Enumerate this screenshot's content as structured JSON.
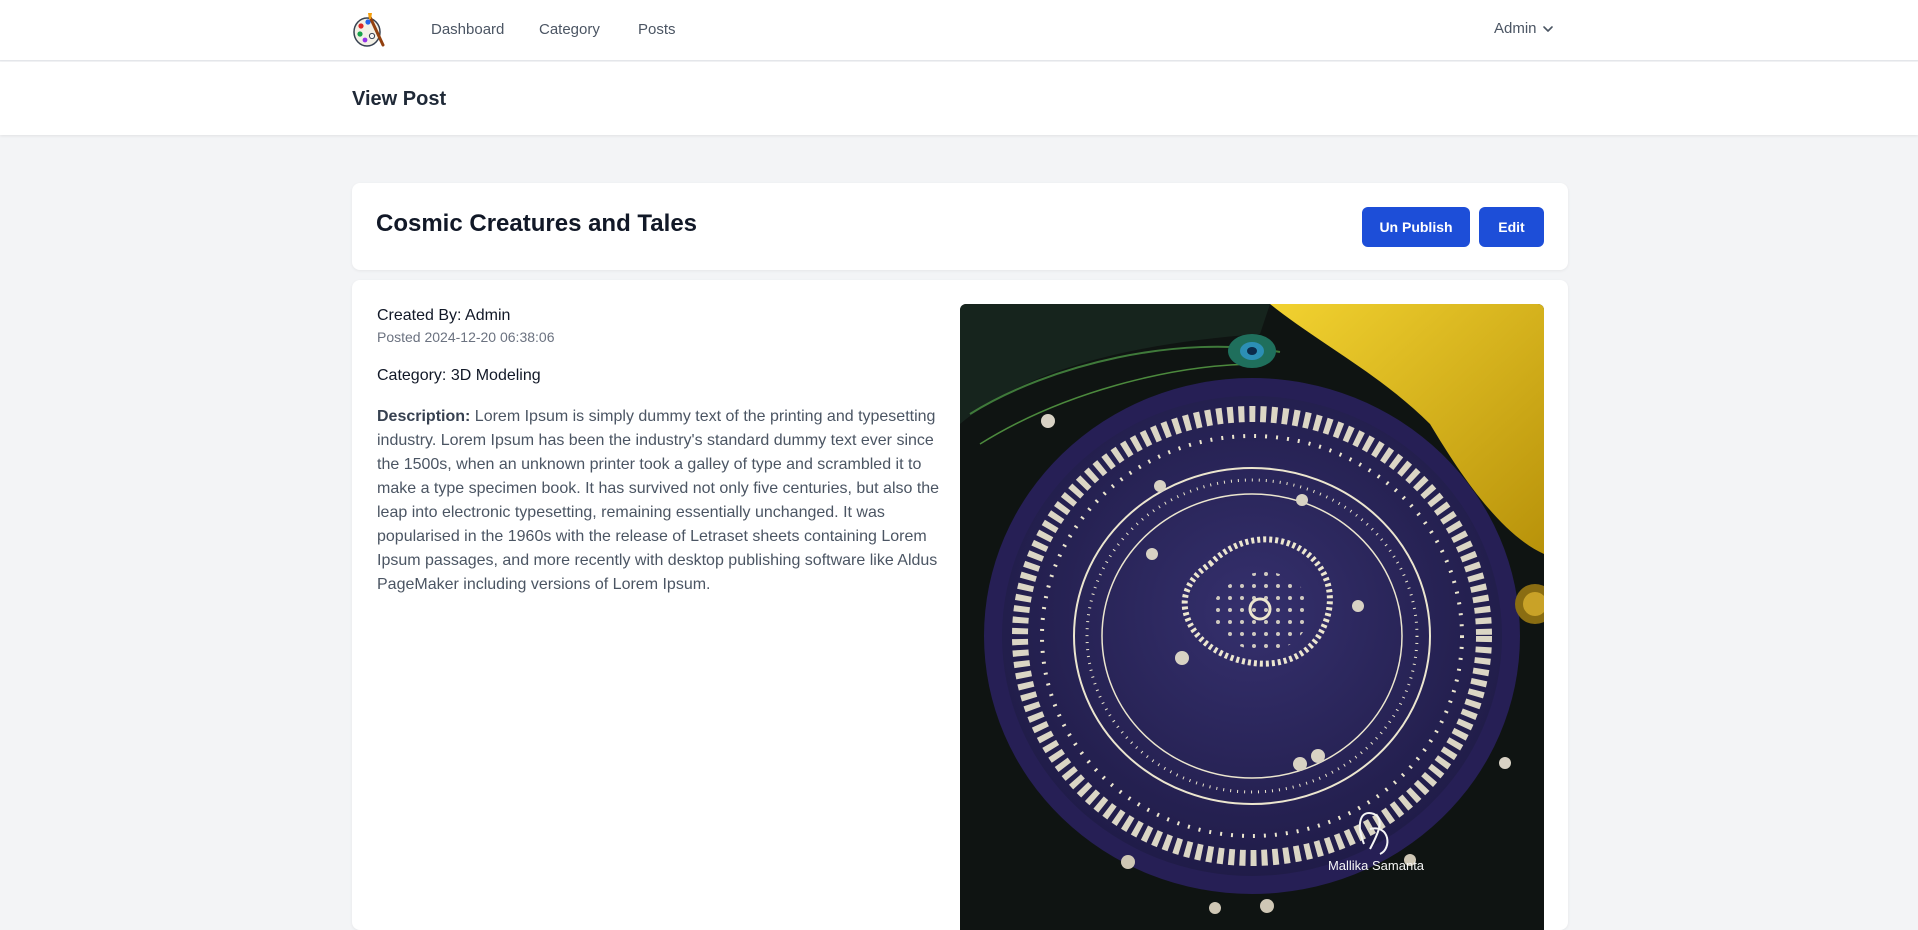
{
  "nav": {
    "logo_icon": "palette-brush-icon",
    "links": [
      "Dashboard",
      "Category",
      "Posts"
    ],
    "user": "Admin",
    "user_menu_icon": "chevron-down-icon"
  },
  "header": {
    "title": "View Post"
  },
  "post": {
    "title": "Cosmic Creatures and Tales",
    "actions": {
      "unpublish_label": "Un Publish",
      "edit_label": "Edit"
    },
    "created_by": "Created By: Admin",
    "posted": "Posted 2024-12-20 06:38:06",
    "category": "Category: 3D Modeling",
    "description_label": "Description:",
    "description_text": "Lorem Ipsum is simply dummy text of the printing and typesetting industry. Lorem Ipsum has been the industry's standard dummy text ever since the 1500s, when an unknown printer took a galley of type and scrambled it to make a type specimen book. It has survived not only five centuries, but also the leap into electronic typesetting, remaining essentially unchanged. It was popularised in the 1960s with the release of Letraset sheets containing Lorem Ipsum passages, and more recently with desktop publishing software like Aldus PageMaker including versions of Lorem Ipsum.",
    "image": {
      "subject": "decorated purple plate with white paisley pattern",
      "signature": "Mallika Samanta",
      "colors": {
        "background": "#0f1412",
        "plate": "#2b2458",
        "pattern": "#ece6cf",
        "fabric": "#e7c21b"
      }
    }
  },
  "colors": {
    "primary": "#1d4ed8",
    "page_bg": "#f3f4f6"
  }
}
